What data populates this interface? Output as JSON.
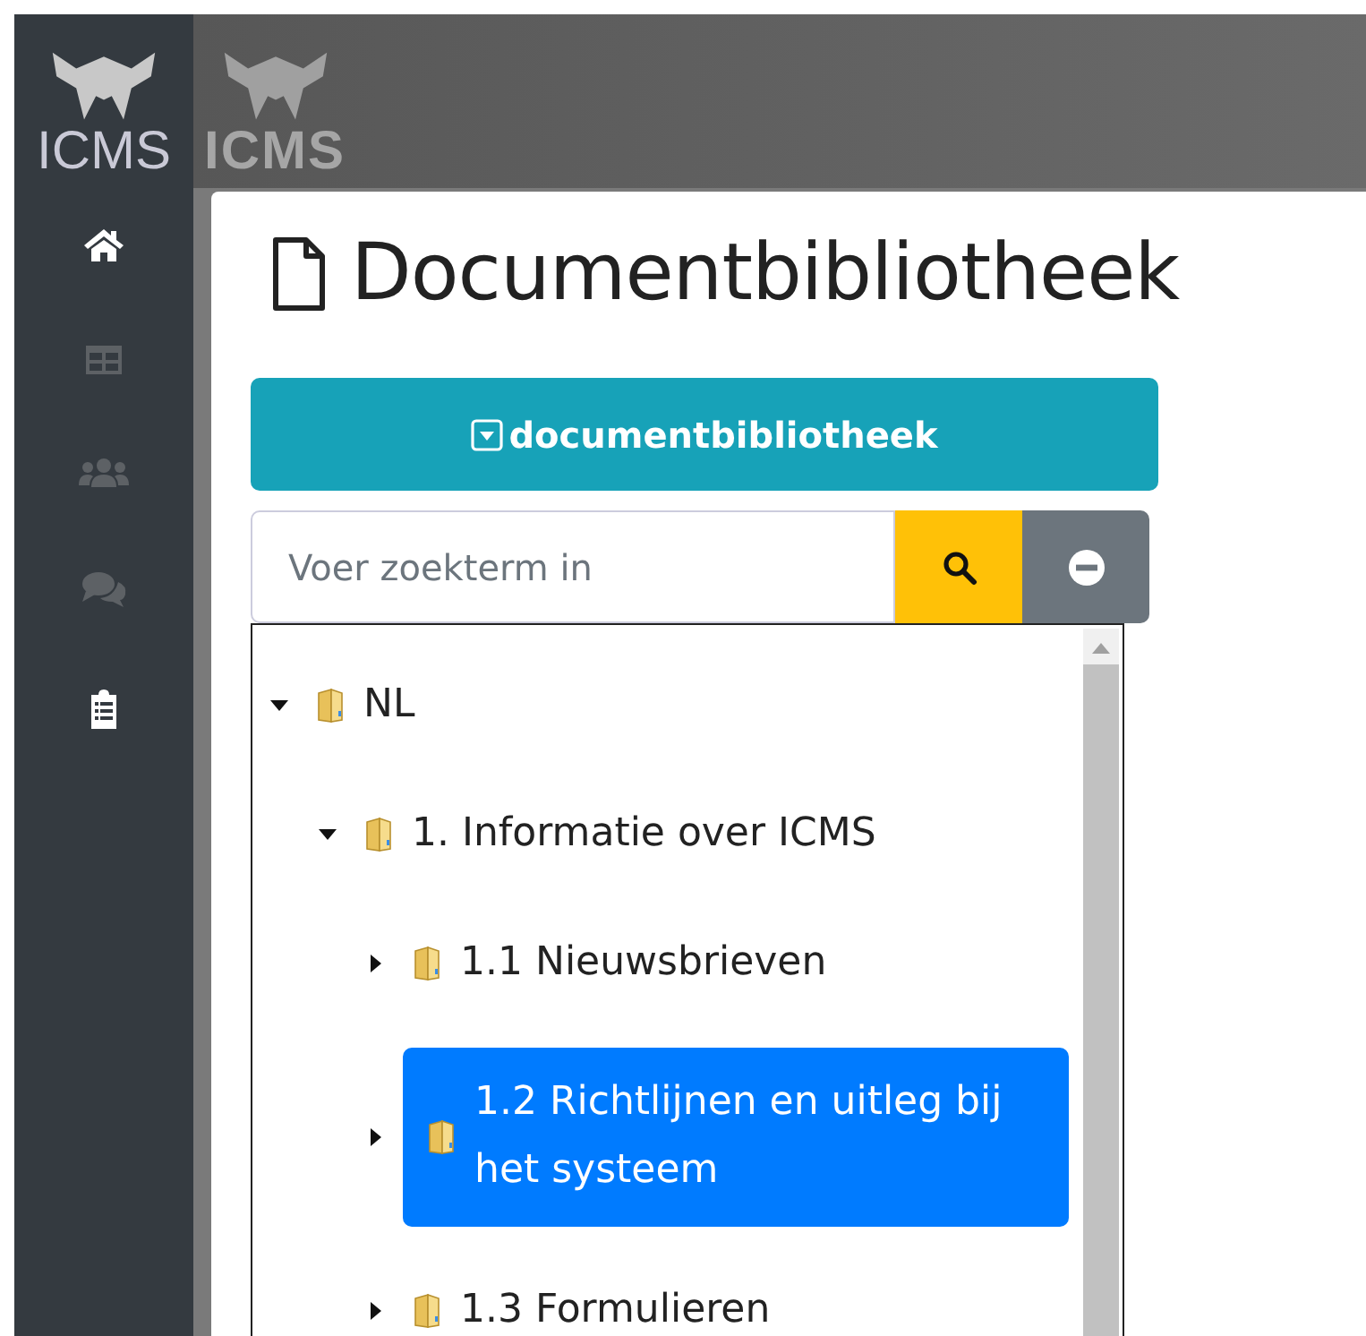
{
  "sidebar": {
    "logo_text": "ICMS",
    "items": [
      {
        "kind": "home",
        "disabled": false
      },
      {
        "kind": "table",
        "disabled": true
      },
      {
        "kind": "users",
        "disabled": true
      },
      {
        "kind": "comments",
        "disabled": true
      },
      {
        "kind": "clipboard",
        "disabled": false
      }
    ]
  },
  "header": {
    "logo_text": "ICMS"
  },
  "page": {
    "title": "Documentbibliotheek"
  },
  "library_button": {
    "label": "documentbibliotheek"
  },
  "search": {
    "placeholder": "Voer zoekterm in"
  },
  "tree": [
    {
      "label": "NL",
      "expanded": true,
      "selected": false,
      "children": [
        {
          "label": "1. Informatie over ICMS",
          "expanded": true,
          "selected": false,
          "children": [
            {
              "label": "1.1 Nieuwsbrieven",
              "expanded": false,
              "selected": false
            },
            {
              "label": "1.2 Richtlijnen en uitleg bij het systeem",
              "expanded": false,
              "selected": true
            },
            {
              "label": "1.3 Formulieren",
              "expanded": false,
              "selected": false
            }
          ]
        }
      ]
    }
  ]
}
